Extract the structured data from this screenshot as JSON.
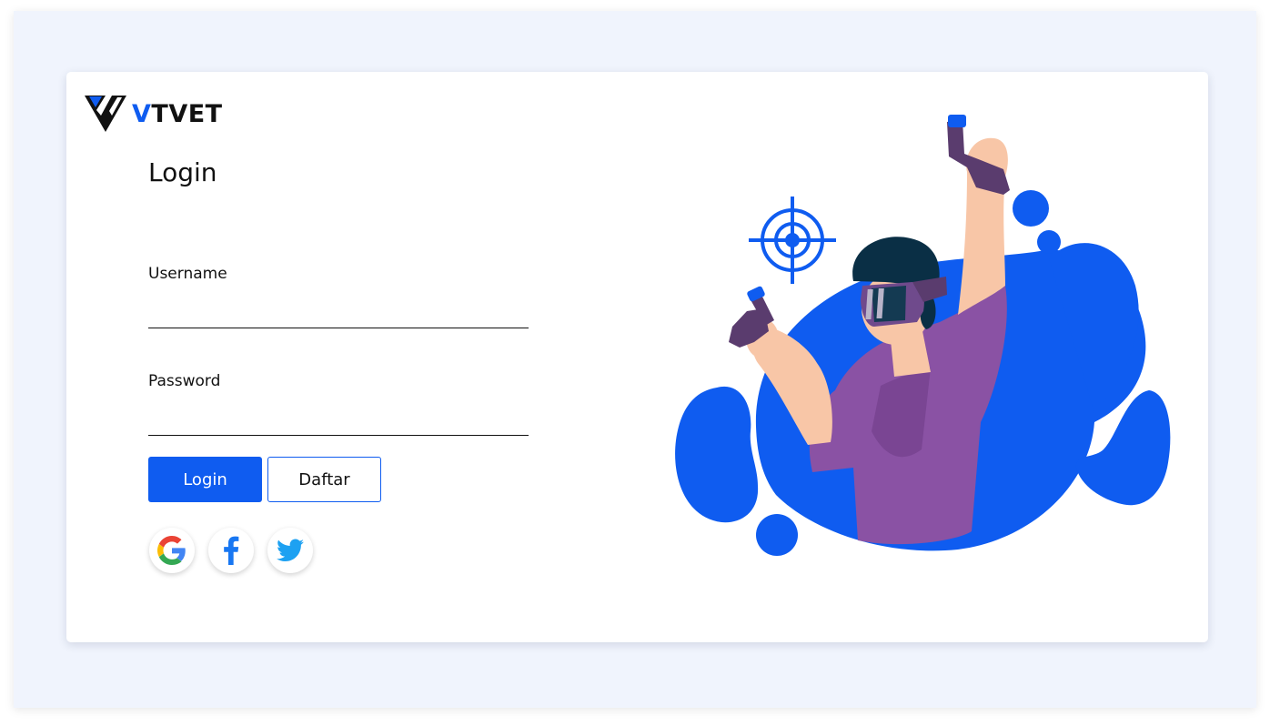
{
  "brand": {
    "initial": "V",
    "rest": "TVET"
  },
  "login": {
    "title": "Login",
    "username_label": "Username",
    "username_value": "",
    "password_label": "Password",
    "password_value": "",
    "login_button": "Login",
    "register_button": "Daftar"
  },
  "social": [
    {
      "icon": "google-icon"
    },
    {
      "icon": "facebook-icon"
    },
    {
      "icon": "twitter-icon"
    }
  ],
  "colors": {
    "accent": "#0f5cf0",
    "page_background": "#f0f4fd",
    "card_background": "#ffffff"
  },
  "illustration": {
    "icon": "vr-player-illustration"
  }
}
